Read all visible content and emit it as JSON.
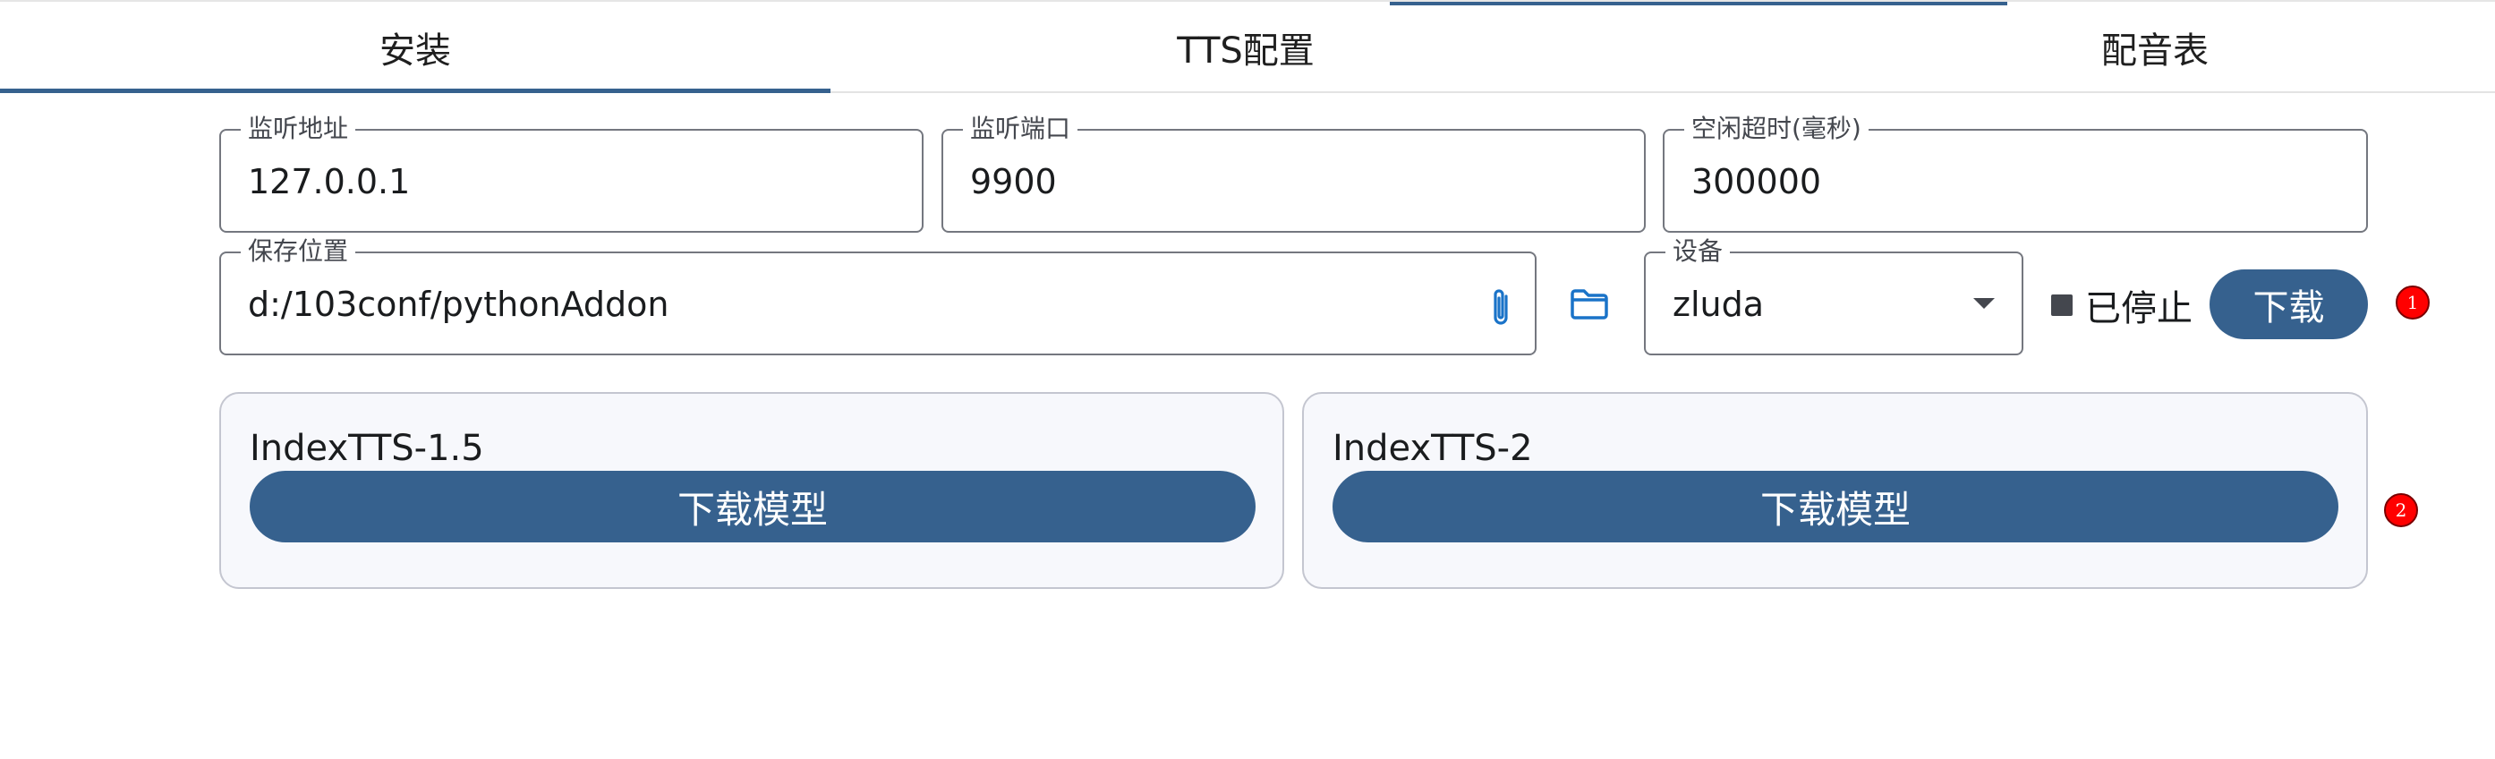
{
  "tabs": [
    {
      "label": "安装",
      "active": true
    },
    {
      "label": "TTS配置",
      "active": false
    },
    {
      "label": "配音表",
      "active": false
    }
  ],
  "fields": {
    "listen_address": {
      "label": "监听地址",
      "value": "127.0.0.1"
    },
    "listen_port": {
      "label": "监听端口",
      "value": "9900"
    },
    "idle_timeout": {
      "label": "空闲超时(毫秒)",
      "value": "300000"
    },
    "save_location": {
      "label": "保存位置",
      "value": "d:/103conf/pythonAddon"
    },
    "device": {
      "label": "设备",
      "value": "zluda"
    }
  },
  "status": {
    "text": "已停止"
  },
  "download_button": {
    "label": "下载"
  },
  "badges": [
    "1",
    "2"
  ],
  "models": [
    {
      "name": "IndexTTS-1.5",
      "button_label": "下载模型"
    },
    {
      "name": "IndexTTS-2",
      "button_label": "下载模型"
    }
  ],
  "colors": {
    "primary": "#36618e",
    "card_bg": "#f7f8fc",
    "badge": "#ff0000",
    "icon_blue": "#1a73c8"
  },
  "icons": {
    "attach": "paperclip-icon",
    "folder": "folder-icon",
    "dropdown": "chevron-down-icon",
    "status": "stop-square-icon"
  }
}
